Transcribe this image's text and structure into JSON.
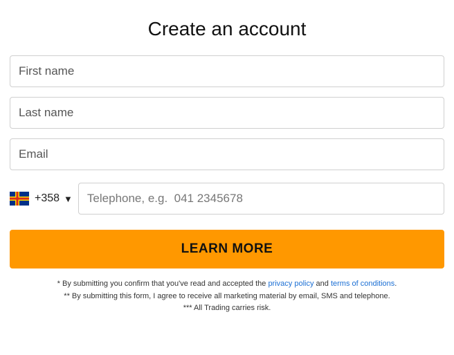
{
  "title": "Create an account",
  "fields": {
    "first_name_placeholder": "First name",
    "last_name_placeholder": "Last name",
    "email_placeholder": "Email",
    "dial_code": "+358",
    "phone_placeholder": "Telephone, e.g.  041 2345678"
  },
  "button_label": "LEARN MORE",
  "disclaimers": {
    "line1_prefix": "* By submitting you confirm that you've read and accepted the ",
    "privacy_link": "privacy policy",
    "line1_mid": " and ",
    "terms_link": "terms of conditions",
    "line1_suffix": ".",
    "line2": "** By submitting this form, I agree to receive all marketing material by email, SMS and telephone.",
    "line3": "*** All Trading carries risk."
  }
}
